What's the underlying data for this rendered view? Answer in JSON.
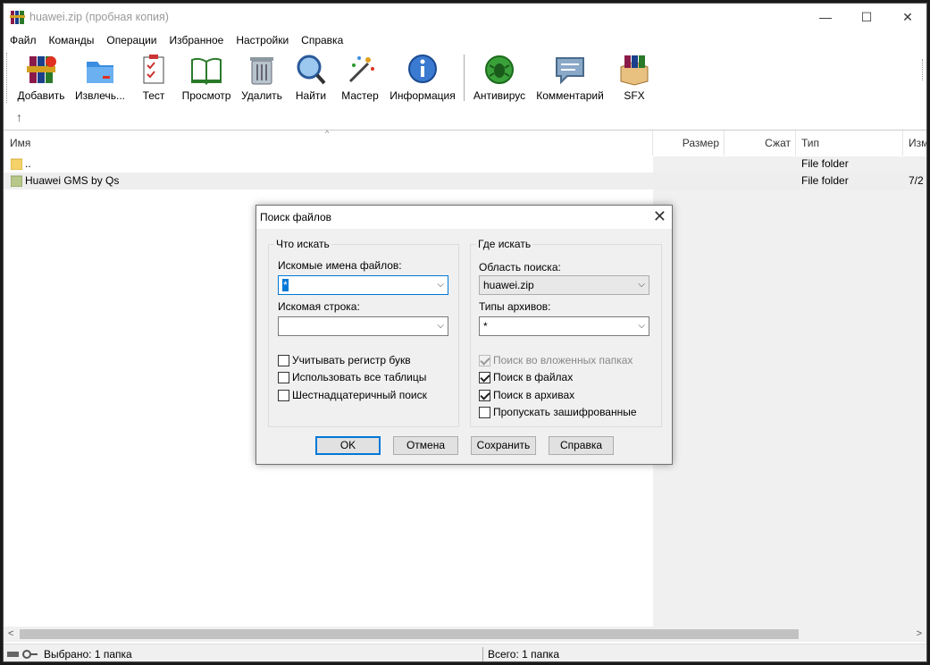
{
  "window": {
    "title": "huawei.zip (пробная копия)",
    "controls": {
      "minimize": "—",
      "maximize": "☐",
      "close": "✕"
    }
  },
  "menu": [
    "Файл",
    "Команды",
    "Операции",
    "Избранное",
    "Настройки",
    "Справка"
  ],
  "toolbar": [
    {
      "label": "Добавить",
      "icon": "add-archive-icon"
    },
    {
      "label": "Извлечь...",
      "icon": "extract-icon"
    },
    {
      "label": "Тест",
      "icon": "test-icon"
    },
    {
      "label": "Просмотр",
      "icon": "view-icon"
    },
    {
      "label": "Удалить",
      "icon": "delete-icon"
    },
    {
      "label": "Найти",
      "icon": "find-icon"
    },
    {
      "label": "Мастер",
      "icon": "wizard-icon"
    },
    {
      "label": "Информация",
      "icon": "info-icon"
    },
    {
      "label": "Антивирус",
      "icon": "antivirus-icon"
    },
    {
      "label": "Комментарий",
      "icon": "comment-icon"
    },
    {
      "label": "SFX",
      "icon": "sfx-icon"
    }
  ],
  "list": {
    "columns": [
      "Имя",
      "Размер",
      "Сжат",
      "Тип",
      "Изм"
    ],
    "rows": [
      {
        "name": "..",
        "type": "File folder",
        "modified": ""
      },
      {
        "name": "Huawei GMS by Qs",
        "type": "File folder",
        "modified": "7/2"
      }
    ]
  },
  "status": {
    "left": "Выбрано: 1 папка",
    "right": "Всего: 1 папка"
  },
  "dialog": {
    "title": "Поиск файлов",
    "what": {
      "title": "Что искать",
      "names_label": "Искомые имена файлов:",
      "names_value": "*",
      "string_label": "Искомая строка:",
      "string_value": "",
      "checks": [
        {
          "label": "Учитывать регистр букв",
          "checked": false
        },
        {
          "label": "Использовать все таблицы",
          "checked": false
        },
        {
          "label": "Шестнадцатеричный поиск",
          "checked": false
        }
      ]
    },
    "where": {
      "title": "Где искать",
      "area_label": "Область поиска:",
      "area_value": "huawei.zip",
      "types_label": "Типы архивов:",
      "types_value": "*",
      "checks": [
        {
          "label": "Поиск во вложенных папках",
          "checked": true,
          "disabled": true
        },
        {
          "label": "Поиск в файлах",
          "checked": true
        },
        {
          "label": "Поиск в архивах",
          "checked": true
        },
        {
          "label": "Пропускать зашифрованные",
          "checked": false
        }
      ]
    },
    "buttons": {
      "ok": "OK",
      "cancel": "Отмена",
      "save": "Сохранить",
      "help": "Справка"
    }
  }
}
